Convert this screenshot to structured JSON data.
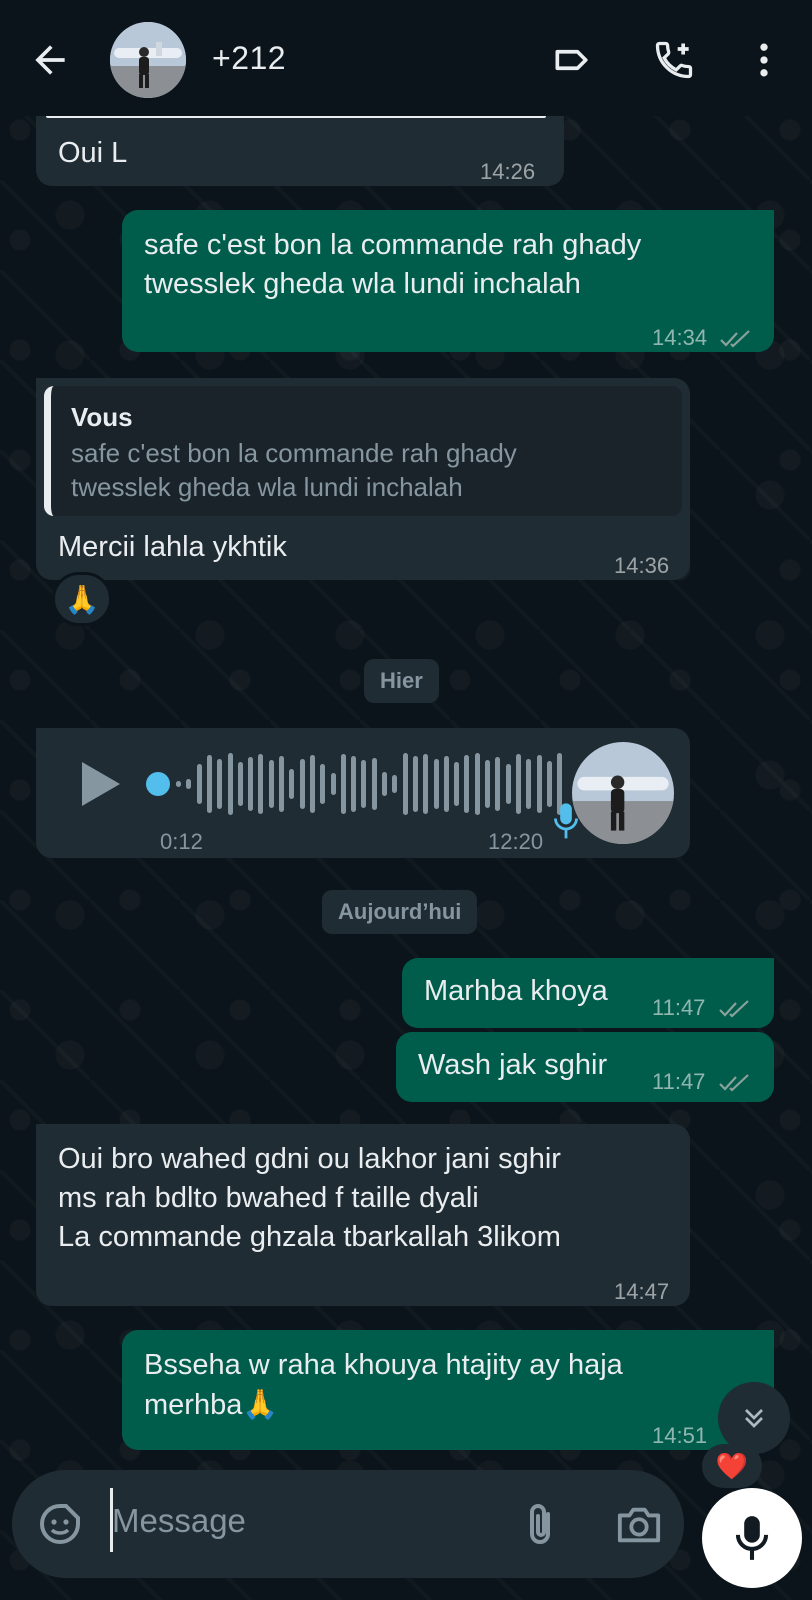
{
  "header": {
    "contact": "+212",
    "icons": [
      "back-arrow-icon",
      "label-icon",
      "add-call-icon",
      "more-vert-icon"
    ]
  },
  "messages": {
    "m1": {
      "text": "Oui L",
      "time": "14:26"
    },
    "m2": {
      "line1": "safe c'est bon la commande rah ghady",
      "line2": "twesslek gheda wla lundi inchalah",
      "time": "14:34"
    },
    "m3": {
      "quote_author": "Vous",
      "quote_line1": "safe c'est bon la commande rah ghady",
      "quote_line2": "twesslek gheda wla lundi inchalah",
      "text": "Mercii lahla ykhtik",
      "time": "14:36",
      "reaction": "🙏"
    },
    "date1": "Hier",
    "voice": {
      "duration": "0:12",
      "time": "12:20"
    },
    "date2": "Aujourd’hui",
    "m4": {
      "text": "Marhba khoya",
      "time": "11:47"
    },
    "m5": {
      "text": "Wash jak sghir",
      "time": "11:47"
    },
    "m6": {
      "line1": "Oui bro wahed gdni ou lakhor jani sghir",
      "line2": "ms rah bdlto bwahed f taille dyali",
      "line3": "La commande ghzala tbarkallah 3likom",
      "time": "14:47"
    },
    "m7": {
      "line1": "Bsseha w raha khouya htajity ay haja",
      "line2": "merhba🙏",
      "time": "14:51",
      "reaction": "❤️"
    }
  },
  "composer": {
    "placeholder": "Message",
    "icons": [
      "emoji-sticker-icon",
      "attach-icon",
      "camera-icon",
      "mic-icon"
    ]
  },
  "colors": {
    "background": "#0b141a",
    "incoming": "#202c33",
    "outgoing": "#005c4b",
    "voice_dot": "#53bdeb"
  }
}
